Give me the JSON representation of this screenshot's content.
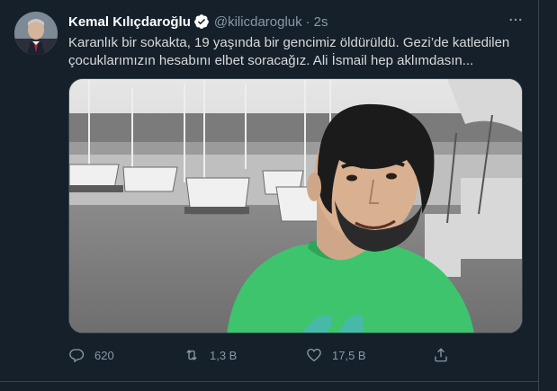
{
  "tweet": {
    "author_name": "Kemal Kılıçdaroğlu",
    "handle": "@kilicdarogluk",
    "separator": "·",
    "time": "2s",
    "text": "Karanlık bir sokakta, 19 yaşında bir gencimiz öldürüldü. Gezi’de katledilen çocuklarımızın hesabını elbet soracağız. Ali İsmail hep aklımdasın...",
    "more_glyph": "···"
  },
  "actions": {
    "reply_count": "620",
    "retweet_count": "1,3 B",
    "like_count": "17,5 B"
  },
  "icons": {
    "verified": "verified-badge-icon",
    "reply": "reply-icon",
    "retweet": "retweet-icon",
    "like": "heart-icon",
    "share": "share-icon",
    "more": "more-icon"
  },
  "colors": {
    "background": "#15202b",
    "border": "#38444d",
    "name": "#ffffff",
    "text": "#d9d9d9",
    "secondary": "#8899a6",
    "verified": "#ffffff",
    "shirt": "#3ec46d"
  }
}
